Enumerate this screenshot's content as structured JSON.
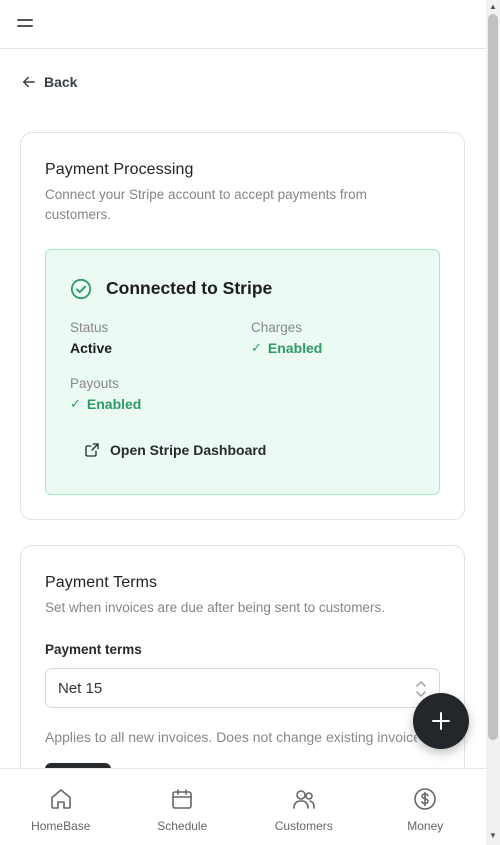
{
  "header": {
    "menu_icon": "hamburger-icon"
  },
  "back": {
    "label": "Back",
    "icon": "arrow-left-icon"
  },
  "payment_processing": {
    "title": "Payment Processing",
    "description": "Connect your Stripe account to accept payments from customers.",
    "connection": {
      "icon": "check-circle-icon",
      "title": "Connected to Stripe",
      "status_label": "Status",
      "status_value": "Active",
      "charges_label": "Charges",
      "charges_value": "Enabled",
      "payouts_label": "Payouts",
      "payouts_value": "Enabled",
      "check_glyph": "✓",
      "dashboard_label": "Open Stripe Dashboard",
      "dashboard_icon": "external-link-icon"
    }
  },
  "payment_terms": {
    "title": "Payment Terms",
    "description": "Set when invoices are due after being sent to customers.",
    "field_label": "Payment terms",
    "selected": "Net 15",
    "help": "Applies to all new invoices. Does not change existing invoices."
  },
  "fab": {
    "icon": "plus-icon"
  },
  "nav": {
    "items": [
      {
        "label": "HomeBase",
        "icon": "home-icon"
      },
      {
        "label": "Schedule",
        "icon": "calendar-icon"
      },
      {
        "label": "Customers",
        "icon": "users-icon"
      },
      {
        "label": "Money",
        "icon": "dollar-circle-icon"
      }
    ]
  },
  "colors": {
    "success_green": "#2e9b67",
    "success_bg": "#ebfaf3",
    "fab_bg": "#23262a"
  }
}
